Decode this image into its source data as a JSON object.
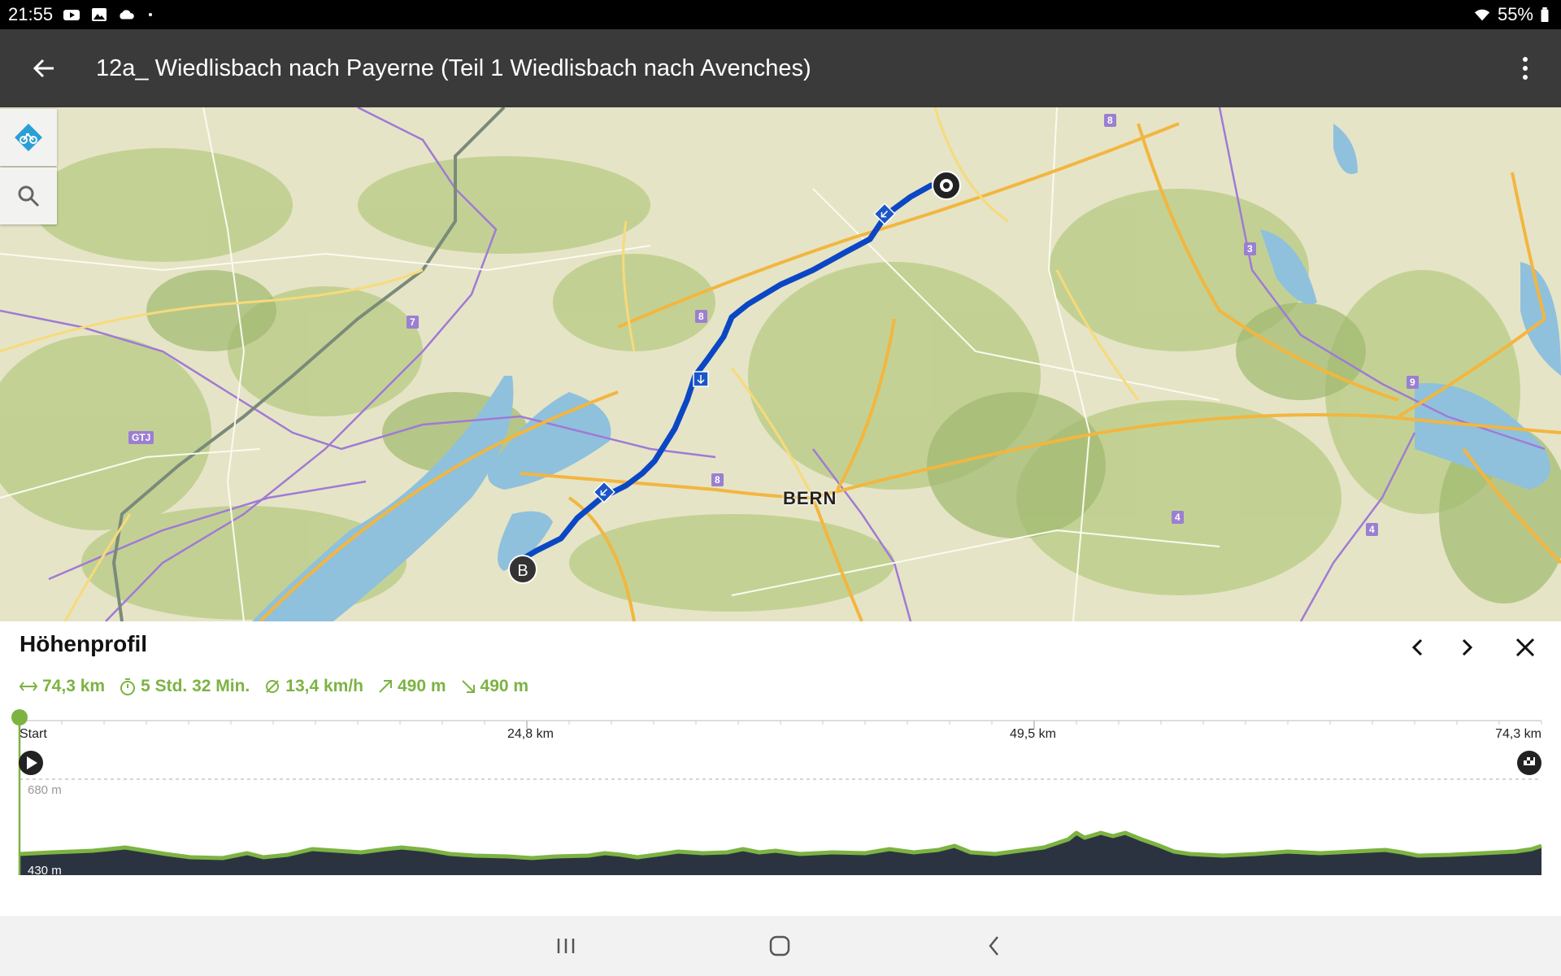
{
  "status_bar": {
    "time": "21:55",
    "left_icons": [
      "youtube-icon",
      "gallery-icon",
      "cloud-icon",
      "dot-icon"
    ],
    "battery": "55%",
    "right_icons": [
      "wifi-icon",
      "battery-icon"
    ]
  },
  "app_bar": {
    "title": "12a_ Wiedlisbach nach Payerne (Teil 1 Wiedlisbach nach Avenches)",
    "back_icon": "arrow-left-icon",
    "menu_icon": "more-vert-icon"
  },
  "map": {
    "buttons": [
      {
        "name": "bike-mode",
        "icon": "bike-icon"
      },
      {
        "name": "search",
        "icon": "search-icon"
      }
    ],
    "city_label": "BERN",
    "route_numbers": [
      "8",
      "8",
      "8",
      "7",
      "3",
      "9",
      "4",
      "4",
      "GTJ"
    ],
    "start_marker": "B",
    "route_color": "#0b47c4"
  },
  "elevation": {
    "title": "Höhenprofil",
    "stats": {
      "distance": "74,3 km",
      "duration": "5 Std. 32 Min.",
      "avg_speed": "13,4 km/h",
      "ascent": "490 m",
      "descent": "490 m"
    },
    "axis_labels": [
      "Start",
      "24,8 km",
      "49,5 km",
      "74,3 km"
    ],
    "y_max_label": "680 m",
    "y_min_label": "430 m",
    "accent_color": "#7cb342",
    "fill_color": "#2b3340"
  },
  "nav_bar": {
    "icons": [
      "recents-icon",
      "home-icon",
      "back-icon"
    ]
  }
}
